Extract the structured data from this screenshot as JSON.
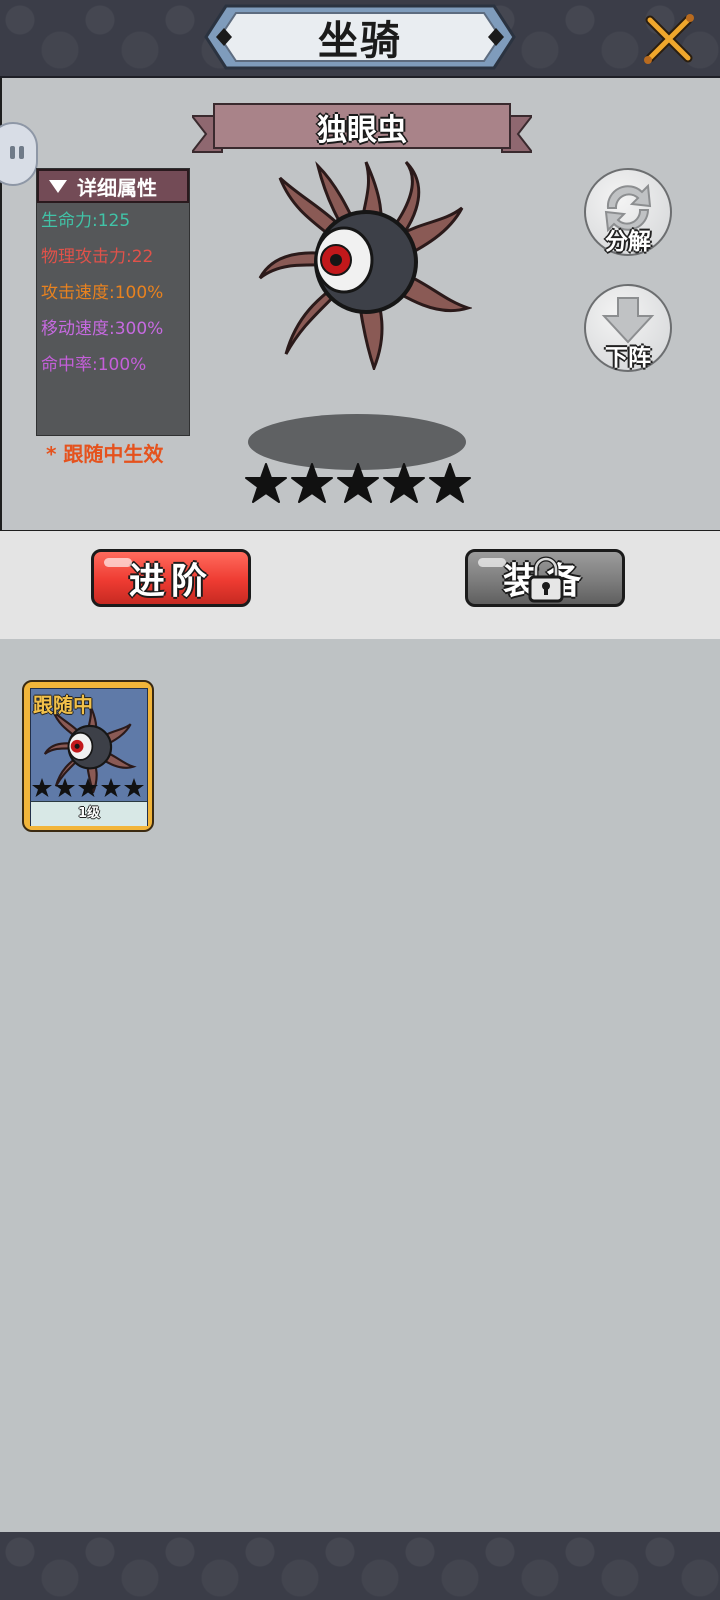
{
  "header": {
    "title": "坐骑",
    "close_icon": "crossed-swords-close-icon"
  },
  "mount": {
    "name": "独眼虫",
    "stats_title": "详细属性",
    "stats": [
      {
        "label": "生命力:125",
        "color": "#41c3a7"
      },
      {
        "label": "物理攻击力:22",
        "color": "#e0524a"
      },
      {
        "label": "攻击速度:100%",
        "color": "#e8821f"
      },
      {
        "label": "移动速度:300%",
        "color": "#c66ae0"
      },
      {
        "label": "命中率:100%",
        "color": "#c45fd9"
      }
    ],
    "follow_note": "* 跟随中生效",
    "stars": 5
  },
  "side_buttons": {
    "decompose": "分解",
    "dismount": "下阵"
  },
  "actions": {
    "advance": "进阶",
    "equip": "装备",
    "equip_locked": true
  },
  "list": [
    {
      "tag": "跟随中",
      "level": "1级",
      "stars": 5
    }
  ],
  "colors": {
    "advance": "#ee3b32",
    "card_border": "#f2b53a"
  }
}
